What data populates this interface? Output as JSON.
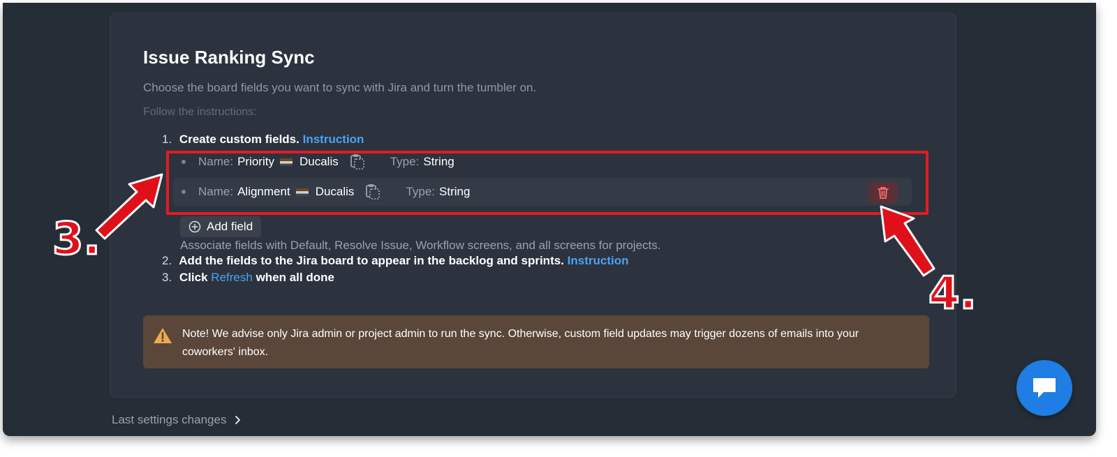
{
  "section": {
    "title": "Issue Ranking Sync",
    "subtitle": "Choose the board fields you want to sync with Jira and turn the tumbler on.",
    "hint": "Follow the instructions:"
  },
  "steps": [
    {
      "number": "1.",
      "text": "Create custom fields.",
      "link": "Instruction"
    },
    {
      "number": "2.",
      "text": "Add the fields to the Jira board to appear in the backlog and sprints.",
      "link": "Instruction"
    },
    {
      "number": "3.",
      "prefix": "Click",
      "link": "Refresh",
      "suffix": "when all done"
    }
  ],
  "fields": [
    {
      "name_label": "Name:",
      "name": "Priority",
      "suffix": "Ducalis",
      "type_label": "Type:",
      "type": "String"
    },
    {
      "name_label": "Name:",
      "name": "Alignment",
      "suffix": "Ducalis",
      "type_label": "Type:",
      "type": "String"
    }
  ],
  "add_field_label": "Add field",
  "associate_text": "Associate fields with Default, Resolve Issue, Workflow screens, and all screens for projects.",
  "note": "Note! We advise only Jira admin or project admin to run the sync. Otherwise, custom field updates may trigger dozens of emails into your coworkers' inbox.",
  "last_changes": "Last settings changes",
  "annotations": {
    "callout_3": "3.",
    "callout_4": "4."
  },
  "colors": {
    "accent": "#4ba3f0",
    "highlight": "#e31b23",
    "chat": "#1f7de3",
    "note_bg": "#5a4739"
  }
}
